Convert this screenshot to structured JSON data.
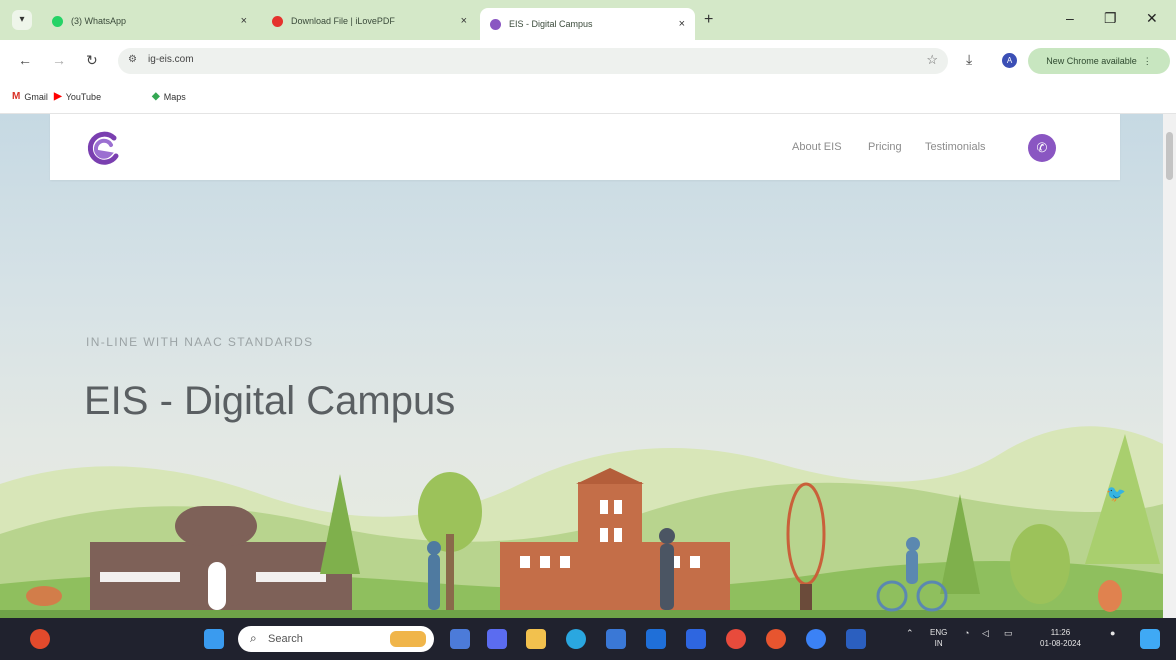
{
  "browser": {
    "tabs": [
      {
        "title": "(3) WhatsApp",
        "favicon": "whatsapp-icon",
        "color": "#25d366",
        "active": false
      },
      {
        "title": "Download File | iLovePDF",
        "favicon": "ilovepdf-icon",
        "color": "#e5322d",
        "active": false
      },
      {
        "title": "EIS - Digital Campus",
        "favicon": "eis-icon",
        "color": "#8a56c2",
        "active": true
      }
    ],
    "close_glyph": "×",
    "new_tab_glyph": "+",
    "url": "ig-eis.com",
    "update_label": "New Chrome available",
    "profile_initial": "A",
    "bookmarks": [
      {
        "label": "Gmail",
        "icon": "gmail-icon"
      },
      {
        "label": "YouTube",
        "icon": "youtube-icon"
      },
      {
        "label": "Maps",
        "icon": "maps-icon"
      }
    ]
  },
  "site": {
    "nav": [
      "About EIS",
      "Pricing",
      "Testimonials"
    ],
    "eyebrow": "IN-LINE WITH NAAC STANDARDS",
    "title": "EIS - Digital Campus",
    "brand_color": "#8a56c2"
  },
  "taskbar": {
    "search_placeholder": "Search",
    "lang_top": "ENG",
    "lang_bottom": "IN",
    "time": "11:26",
    "date": "01-08-2024"
  }
}
